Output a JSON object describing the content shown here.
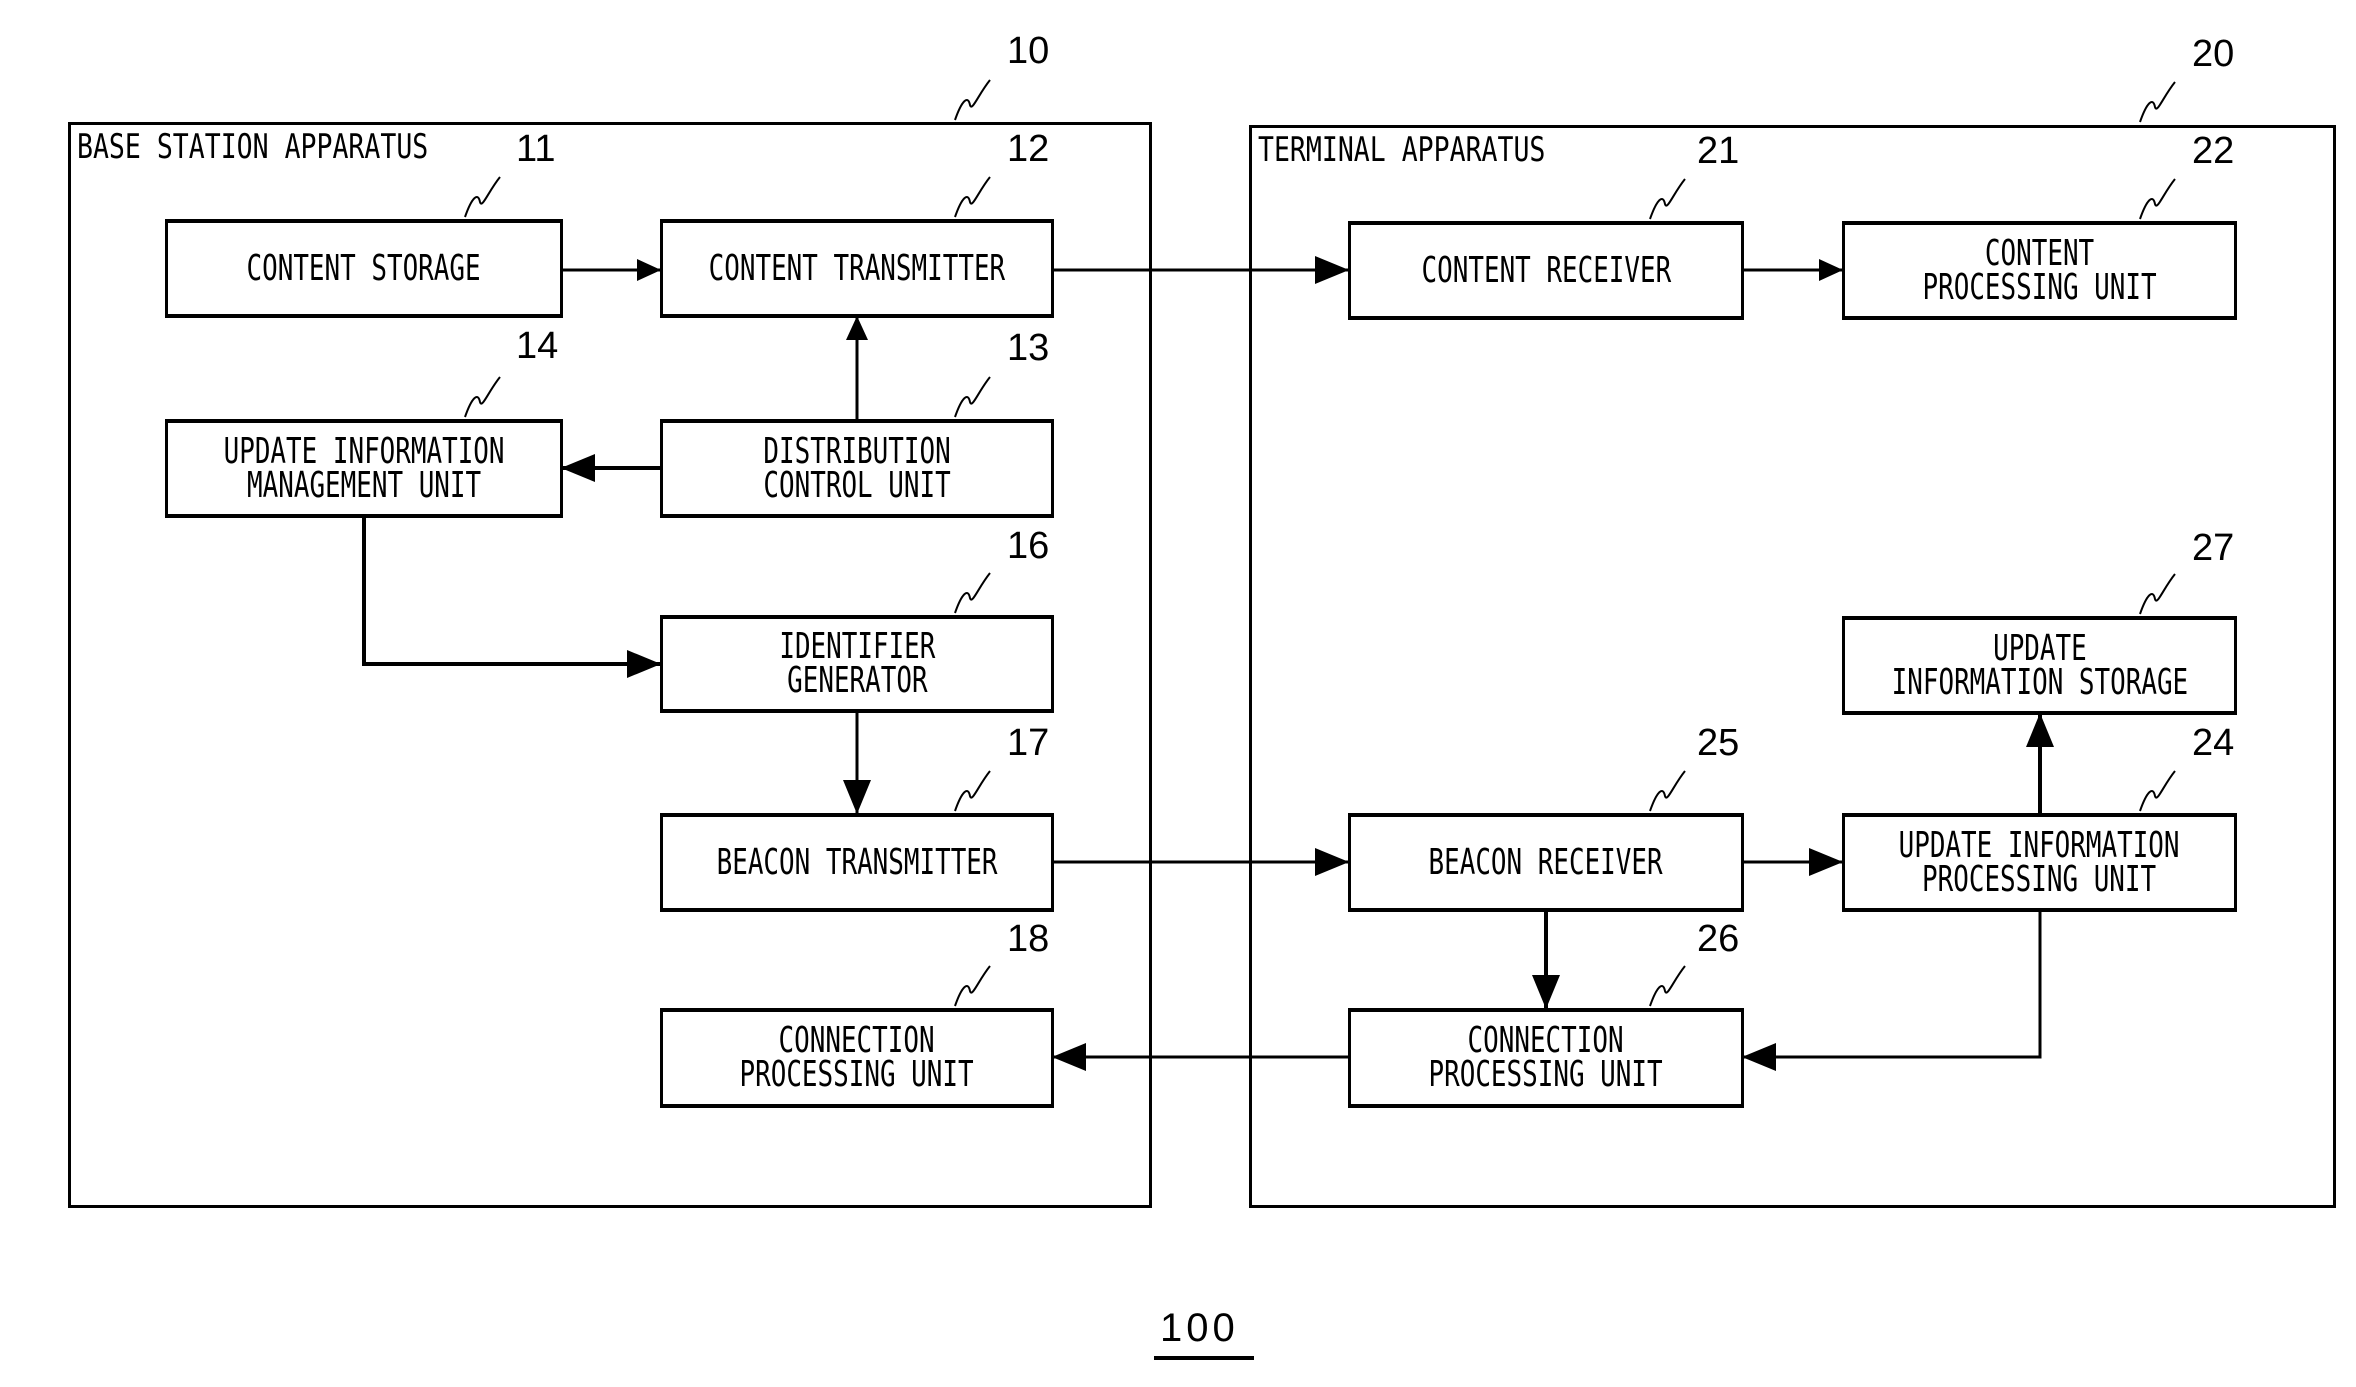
{
  "figure": {
    "label": "100",
    "apparatus": [
      {
        "id": "base",
        "title": "BASE STATION APPARATUS",
        "ref": "10"
      },
      {
        "id": "terminal",
        "title": "TERMINAL APPARATUS",
        "ref": "20"
      }
    ],
    "blocks": {
      "b11": {
        "ref": "11",
        "label": "CONTENT STORAGE"
      },
      "b12": {
        "ref": "12",
        "label": "CONTENT TRANSMITTER"
      },
      "b13": {
        "ref": "13",
        "label": "DISTRIBUTION\nCONTROL UNIT"
      },
      "b14": {
        "ref": "14",
        "label": "UPDATE INFORMATION\nMANAGEMENT UNIT"
      },
      "b16": {
        "ref": "16",
        "label": "IDENTIFIER\nGENERATOR"
      },
      "b17": {
        "ref": "17",
        "label": "BEACON TRANSMITTER"
      },
      "b18": {
        "ref": "18",
        "label": "CONNECTION\nPROCESSING UNIT"
      },
      "b21": {
        "ref": "21",
        "label": "CONTENT RECEIVER"
      },
      "b22": {
        "ref": "22",
        "label": "CONTENT\nPROCESSING UNIT"
      },
      "b24": {
        "ref": "24",
        "label": "UPDATE INFORMATION\nPROCESSING UNIT"
      },
      "b25": {
        "ref": "25",
        "label": "BEACON RECEIVER"
      },
      "b26": {
        "ref": "26",
        "label": "CONNECTION\nPROCESSING UNIT"
      },
      "b27": {
        "ref": "27",
        "label": "UPDATE\nINFORMATION STORAGE"
      }
    },
    "connections": [
      {
        "from": "11",
        "to": "12",
        "type": "arrow"
      },
      {
        "from": "13",
        "to": "12",
        "type": "arrow"
      },
      {
        "from": "13",
        "to": "14",
        "type": "arrow"
      },
      {
        "from": "14",
        "to": "16",
        "type": "arrow"
      },
      {
        "from": "16",
        "to": "17",
        "type": "arrow"
      },
      {
        "from": "12",
        "to": "21",
        "type": "arrow"
      },
      {
        "from": "21",
        "to": "22",
        "type": "arrow"
      },
      {
        "from": "17",
        "to": "25",
        "type": "arrow"
      },
      {
        "from": "25",
        "to": "24",
        "type": "arrow"
      },
      {
        "from": "25",
        "to": "26",
        "type": "arrow"
      },
      {
        "from": "24",
        "to": "26",
        "type": "arrow"
      },
      {
        "from": "24",
        "to": "27",
        "type": "bidirectional"
      },
      {
        "from": "26",
        "to": "18",
        "type": "arrow"
      }
    ]
  }
}
